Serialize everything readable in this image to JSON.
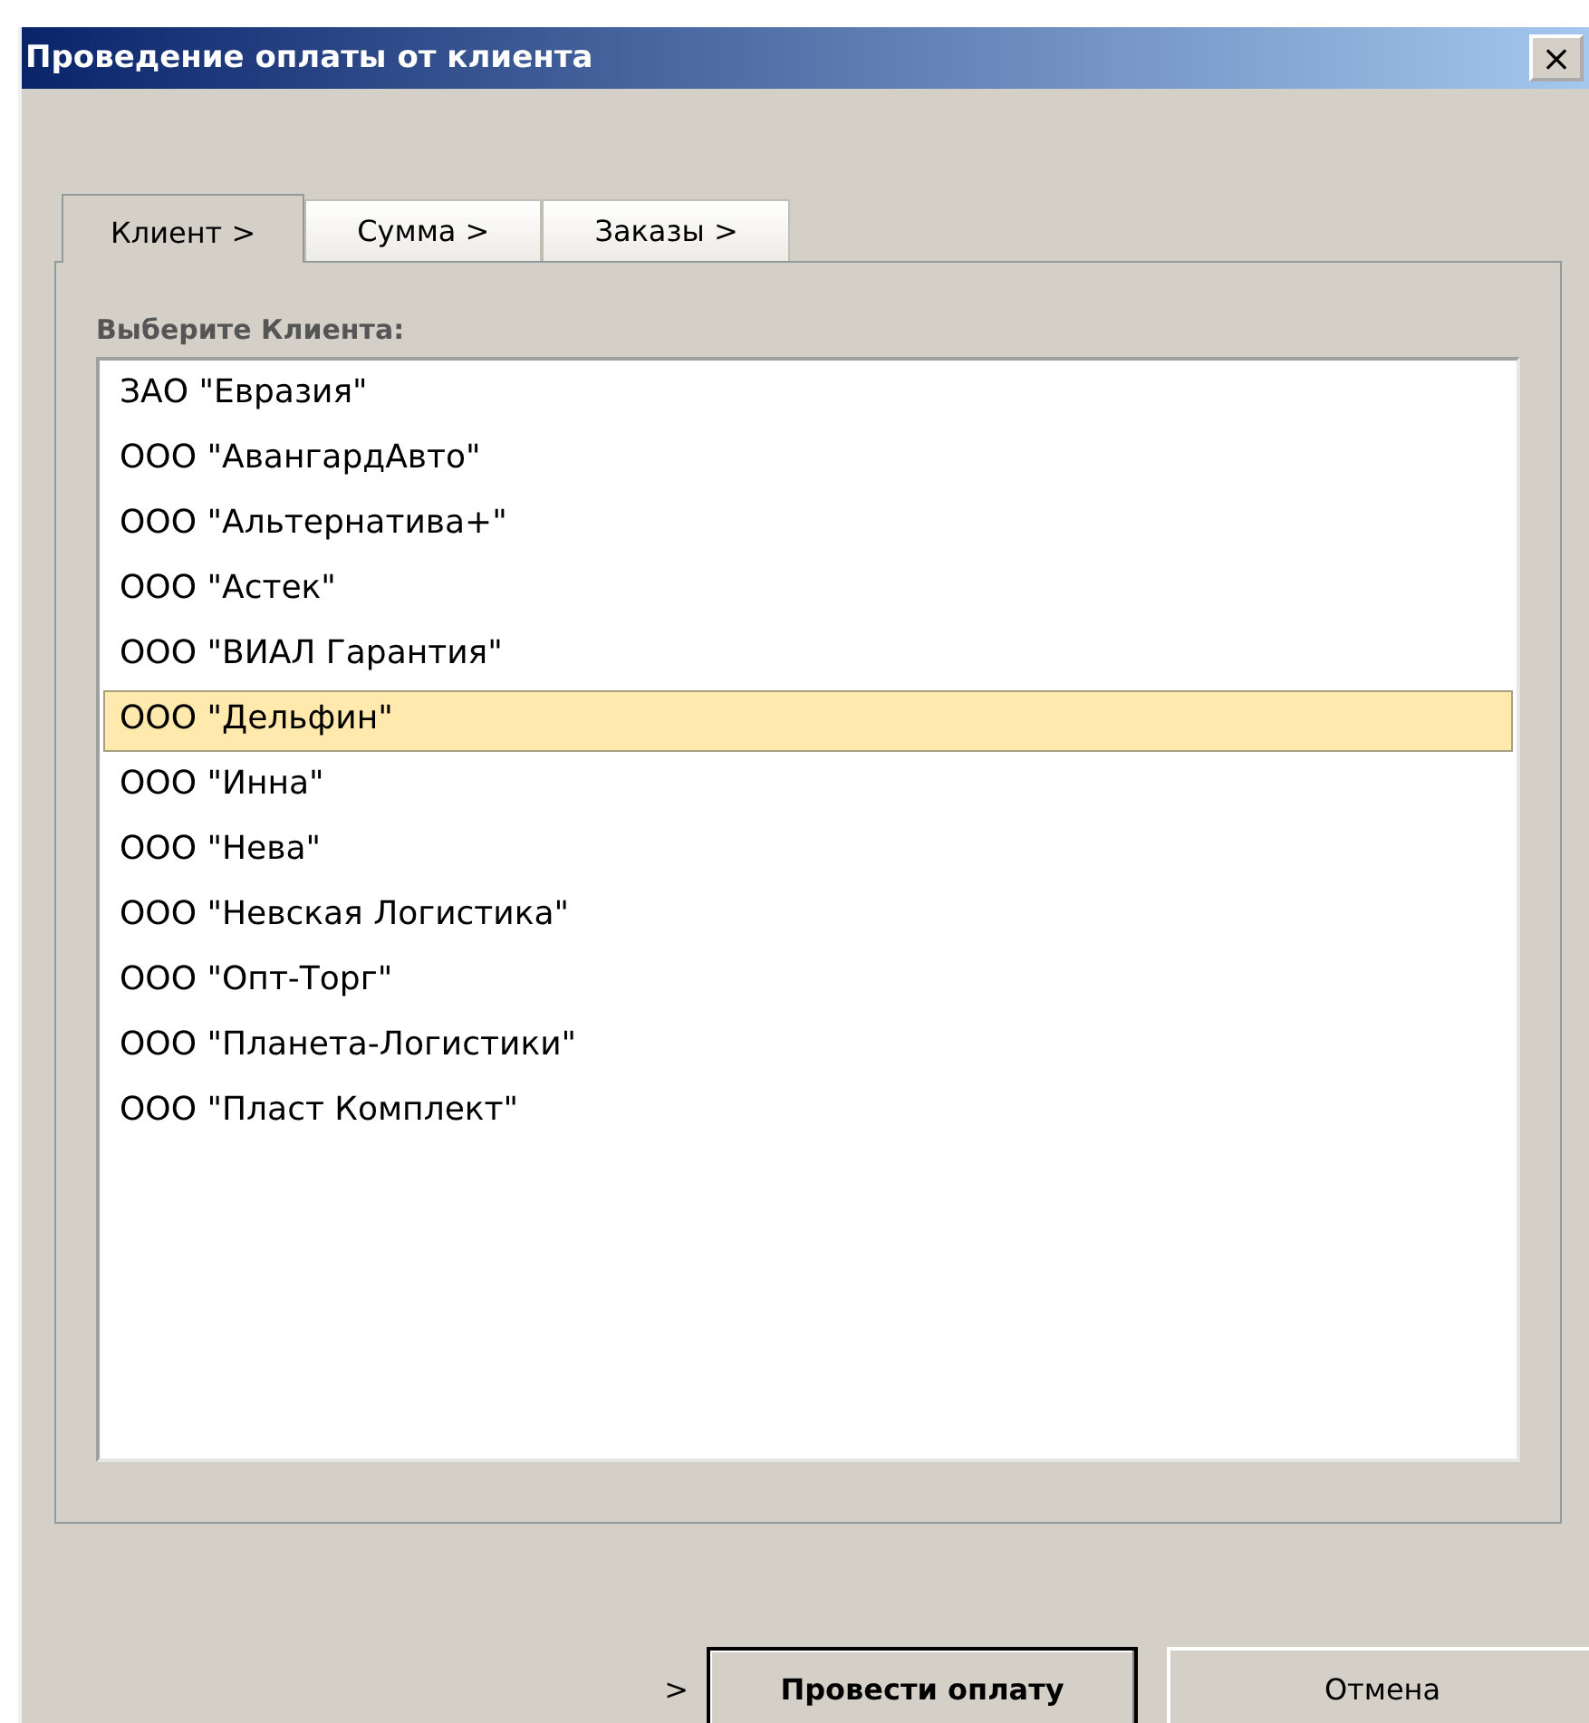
{
  "window": {
    "title": "Проведение оплаты от клиента",
    "close": "×"
  },
  "tabs": [
    {
      "label": "Клиент >",
      "selected": true
    },
    {
      "label": "Сумма >",
      "selected": false
    },
    {
      "label": "Заказы >",
      "selected": false
    }
  ],
  "list_label": "Выберите Клиента:",
  "clients": [
    {
      "name": "ЗАО \"Евразия\"",
      "selected": false
    },
    {
      "name": "ООО \"АвангардАвто\"",
      "selected": false
    },
    {
      "name": "ООО \"Альтернатива+\"",
      "selected": false
    },
    {
      "name": "ООО \"Астек\"",
      "selected": false
    },
    {
      "name": "ООО \"ВИАЛ Гарантия\"",
      "selected": false
    },
    {
      "name": "ООО \"Дельфин\"",
      "selected": true
    },
    {
      "name": "ООО \"Инна\"",
      "selected": false
    },
    {
      "name": "ООО \"Нева\"",
      "selected": false
    },
    {
      "name": "ООО \"Невская Логистика\"",
      "selected": false
    },
    {
      "name": "ООО \"Опт-Торг\"",
      "selected": false
    },
    {
      "name": "ООО \"Планета-Логистики\"",
      "selected": false
    },
    {
      "name": "ООО \"Пласт Комплект\"",
      "selected": false
    }
  ],
  "footer": {
    "marker": ">",
    "buttons": [
      {
        "label": "Провести оплату",
        "kind": "default"
      },
      {
        "label": "Отмена",
        "kind": "normal"
      }
    ]
  }
}
